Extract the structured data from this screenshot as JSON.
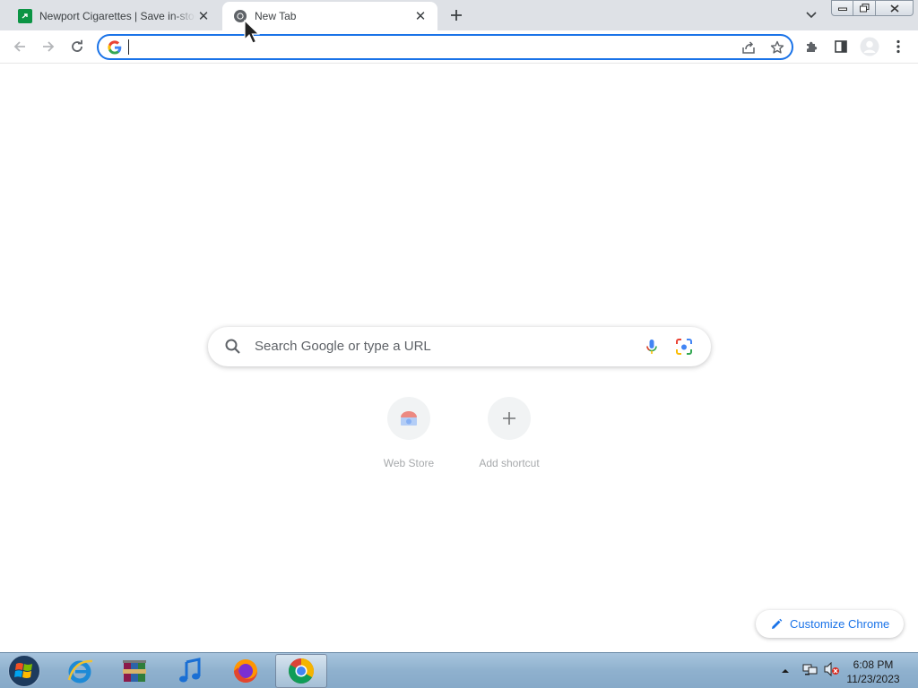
{
  "browser": {
    "tabs": [
      {
        "title": "Newport Cigarettes | Save in-stock",
        "active": false
      },
      {
        "title": "New Tab",
        "active": true
      }
    ],
    "omnibox": {
      "value": "",
      "placeholder": ""
    }
  },
  "ntp": {
    "search_placeholder": "Search Google or type a URL",
    "shortcuts": [
      {
        "label": "Web Store",
        "icon": "web-store-icon"
      },
      {
        "label": "Add shortcut",
        "icon": "plus-icon"
      }
    ],
    "customize_label": "Customize Chrome"
  },
  "taskbar": {
    "apps": [
      "start-orb",
      "internet-explorer",
      "winrar",
      "itunes",
      "firefox",
      "chrome"
    ],
    "active_app": "chrome",
    "clock": {
      "time": "6:08 PM",
      "date": "11/23/2023"
    }
  },
  "colors": {
    "accent": "#1a73e8",
    "tabstrip": "#dee1e6",
    "newport_green": "#0b9444"
  }
}
